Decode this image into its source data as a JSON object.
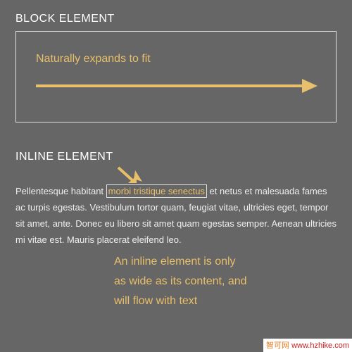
{
  "block": {
    "title": "BLOCK ELEMENT",
    "caption": "Naturally expands to fit"
  },
  "inline": {
    "title": "INLINE ELEMENT",
    "para_before": "Pellentesque habitant ",
    "highlight": "morbi tristique senectus",
    "para_after": " et netus et malesuada fames ac turpis egestas. Vestibulum tortor quam, feugiat vitae, ultricies eget, tempor sit amet, ante. Donec eu libero sit amet quam egestas semper. Aenean ultricies mi vitae est. Mauris placerat eleifend leo.",
    "desc_line1": "An inline element is only",
    "desc_line2": "as wide as its content, and",
    "desc_line3": "will flow with text"
  },
  "watermark": {
    "brand": "智可网",
    "url": "www.hzhike.com"
  },
  "colors": {
    "accent": "#e8bf6a",
    "bg": "#666666"
  }
}
